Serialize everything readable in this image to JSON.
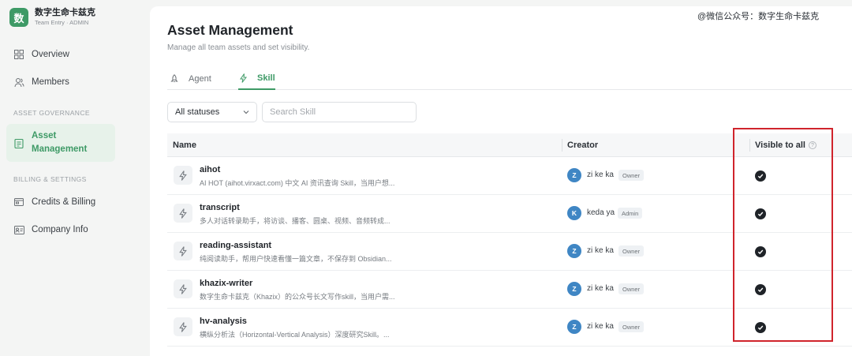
{
  "brand": {
    "logo_char": "数",
    "name": "数字生命卡兹克",
    "sub": "Team Entry · ADMIN"
  },
  "sidebar": {
    "items_top": [
      {
        "label": "Overview",
        "icon": "grid-icon"
      },
      {
        "label": "Members",
        "icon": "members-icon"
      }
    ],
    "section_governance": "ASSET GOVERNANCE",
    "asset_item": {
      "label_line1": "Asset",
      "label_line2": "Management",
      "icon": "clipboard-icon"
    },
    "section_billing": "BILLING & SETTINGS",
    "items_bottom": [
      {
        "label": "Credits & Billing",
        "icon": "wallet-icon"
      },
      {
        "label": "Company Info",
        "icon": "id-card-icon"
      }
    ]
  },
  "header": {
    "title": "Asset Management",
    "subtitle": "Manage all team assets and set visibility."
  },
  "tabs": [
    {
      "label": "Agent",
      "icon": "rocket-icon",
      "active": false
    },
    {
      "label": "Skill",
      "icon": "lightning-icon",
      "active": true
    }
  ],
  "filter": {
    "value": "All statuses"
  },
  "search": {
    "placeholder": "Search Skill"
  },
  "table": {
    "headers": {
      "name": "Name",
      "creator": "Creator",
      "visible": "Visible to all",
      "help": "?"
    },
    "rows": [
      {
        "name": "aihot",
        "desc": "AI HOT (aihot.virxact.com) 中文 AI 资讯查询 Skill，当用户想...",
        "avatar": "Z",
        "creator": "zi ke ka",
        "role": "Owner",
        "visible": true
      },
      {
        "name": "transcript",
        "desc": "多人对话转录助手，将访谈、播客、圆桌、视频、音频转成...",
        "avatar": "K",
        "creator": "keda ya",
        "role": "Admin",
        "visible": true
      },
      {
        "name": "reading-assistant",
        "desc": "纯阅读助手，帮用户快速看懂一篇文章，不保存到 Obsidian...",
        "avatar": "Z",
        "creator": "zi ke ka",
        "role": "Owner",
        "visible": true
      },
      {
        "name": "khazix-writer",
        "desc": "数字生命卡兹克（Khazix）的公众号长文写作skill，当用户需...",
        "avatar": "Z",
        "creator": "zi ke ka",
        "role": "Owner",
        "visible": true
      },
      {
        "name": "hv-analysis",
        "desc": "横纵分析法（Horizontal-Vertical Analysis）深度研究Skill。...",
        "avatar": "Z",
        "creator": "zi ke ka",
        "role": "Owner",
        "visible": true
      }
    ]
  },
  "watermark": "@微信公众号：数字生命卡兹克",
  "colors": {
    "accent": "#3e9a66",
    "highlight": "#d0242c",
    "avatar": "#3f86c4"
  }
}
